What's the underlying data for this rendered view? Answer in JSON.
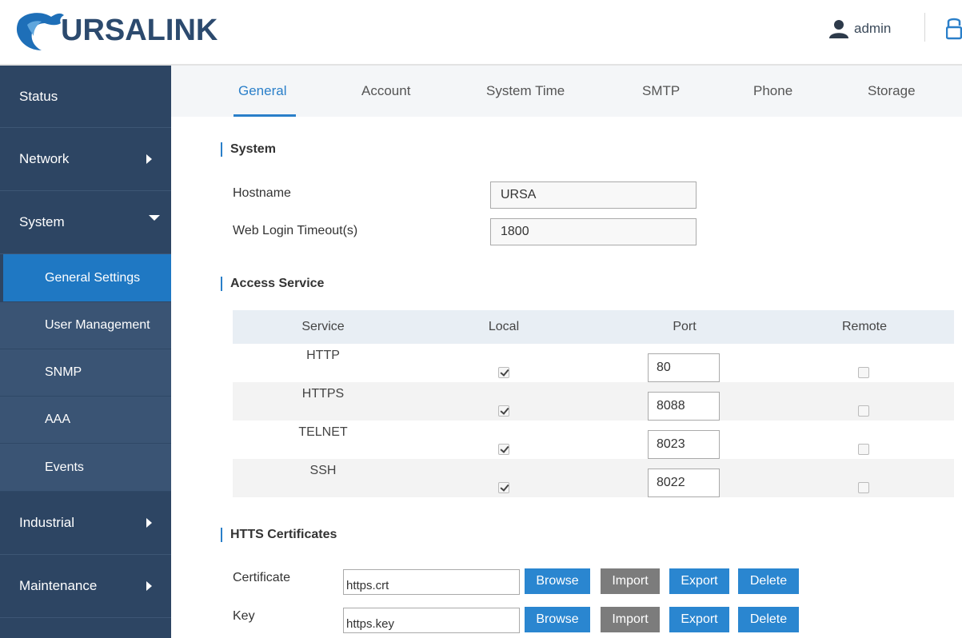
{
  "header": {
    "logo_text": "URSALINK",
    "user_name": "admin",
    "user_icon": "user-icon",
    "logout_icon": "logout-icon"
  },
  "sidebar": {
    "items": [
      {
        "label": "Status"
      },
      {
        "label": "Network"
      },
      {
        "label": "System"
      },
      {
        "label": "General Settings"
      },
      {
        "label": "User Management"
      },
      {
        "label": "SNMP"
      },
      {
        "label": "AAA"
      },
      {
        "label": "Events"
      },
      {
        "label": "Industrial"
      },
      {
        "label": "Maintenance"
      }
    ]
  },
  "tabs": [
    {
      "label": "General"
    },
    {
      "label": "Account"
    },
    {
      "label": "System Time"
    },
    {
      "label": "SMTP"
    },
    {
      "label": "Phone"
    },
    {
      "label": "Storage"
    }
  ],
  "system": {
    "title": "System",
    "hostname_label": "Hostname",
    "hostname_value": "URSA",
    "timeout_label": "Web Login Timeout(s)",
    "timeout_value": "1800"
  },
  "access": {
    "title": "Access Service",
    "headers": {
      "service": "Service",
      "local": "Local",
      "port": "Port",
      "remote": "Remote"
    },
    "rows": [
      {
        "service": "HTTP",
        "local": true,
        "port": "80",
        "remote": false
      },
      {
        "service": "HTTPS",
        "local": true,
        "port": "8088",
        "remote": false
      },
      {
        "service": "TELNET",
        "local": true,
        "port": "8023",
        "remote": false
      },
      {
        "service": "SSH",
        "local": true,
        "port": "8022",
        "remote": false
      }
    ]
  },
  "certs": {
    "title": "HTTS Certificates",
    "rows": [
      {
        "label": "Certificate",
        "value": "https.crt"
      },
      {
        "label": "Key",
        "value": "https.key"
      }
    ],
    "buttons": {
      "browse": "Browse",
      "import": "Import",
      "export": "Export",
      "delete": "Delete"
    }
  },
  "colors": {
    "sidebar": "#2d4563",
    "active": "#1f78c3",
    "accent": "#2a7fc9",
    "button_blue": "#2a86d0",
    "button_gray": "#7c7c7c"
  }
}
